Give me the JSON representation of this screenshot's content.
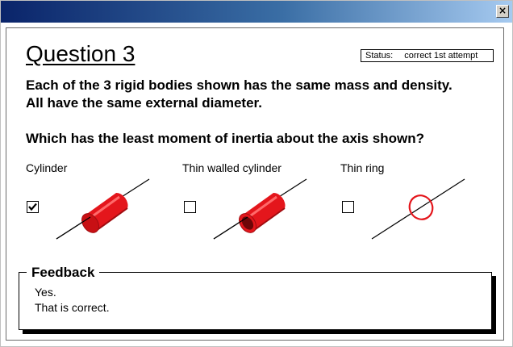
{
  "window": {
    "close_glyph": "×"
  },
  "question": {
    "title": "Question 3",
    "status_label": "Status:",
    "status_value": "correct 1st attempt",
    "body_line1": "Each of the 3 rigid bodies shown has the same mass and density.",
    "body_line2": "All have the same external diameter.",
    "prompt": "Which has the least moment of inertia about the axis shown?"
  },
  "options": [
    {
      "label": "Cylinder",
      "checked": true,
      "icon": "solid-cylinder-icon"
    },
    {
      "label": "Thin walled cylinder",
      "checked": false,
      "icon": "hollow-cylinder-icon"
    },
    {
      "label": "Thin ring",
      "checked": false,
      "icon": "thin-ring-icon"
    }
  ],
  "feedback": {
    "title": "Feedback",
    "line1": "Yes.",
    "line2": "That is correct."
  },
  "colors": {
    "body_red": "#e4161c",
    "body_dark_red": "#a00c10",
    "body_highlight": "#ff6a6a",
    "titlebar": "#0a246a"
  }
}
